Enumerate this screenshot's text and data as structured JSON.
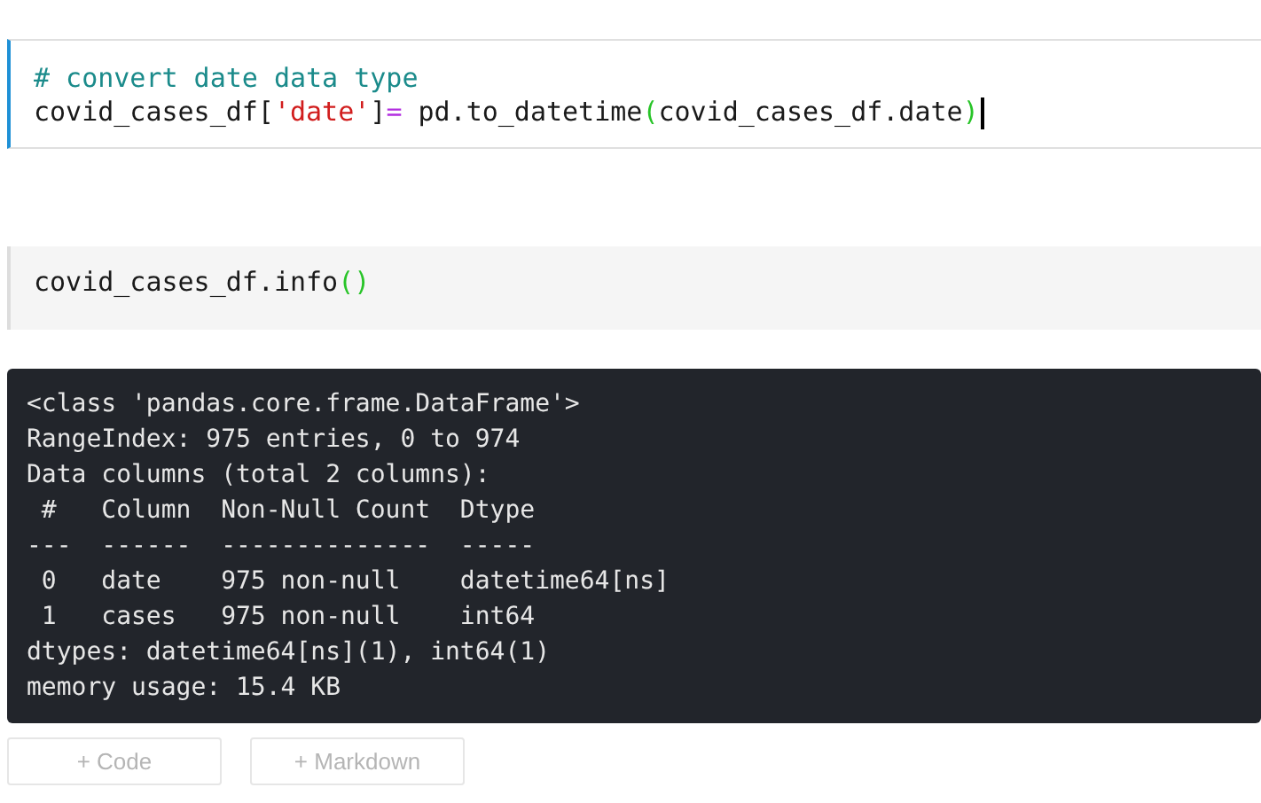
{
  "cells": [
    {
      "kind": "code",
      "active": true,
      "lines": [
        [
          {
            "kind": "comment",
            "text": "# convert date data type"
          }
        ],
        [
          {
            "kind": "plain",
            "text": "covid_cases_df["
          },
          {
            "kind": "string",
            "text": "'date'"
          },
          {
            "kind": "plain",
            "text": "]"
          },
          {
            "kind": "operator",
            "text": "="
          },
          {
            "kind": "plain",
            "text": " pd.to_datetime"
          },
          {
            "kind": "paren",
            "text": "("
          },
          {
            "kind": "plain",
            "text": "covid_cases_df.date"
          },
          {
            "kind": "paren",
            "text": ")"
          }
        ]
      ]
    },
    {
      "kind": "code",
      "active": false,
      "lines": [
        [
          {
            "kind": "plain",
            "text": "covid_cases_df.info"
          },
          {
            "kind": "paren",
            "text": "()"
          }
        ]
      ],
      "output": [
        "<class 'pandas.core.frame.DataFrame'>",
        "RangeIndex: 975 entries, 0 to 974",
        "Data columns (total 2 columns):",
        " #   Column  Non-Null Count  Dtype         ",
        "---  ------  --------------  -----         ",
        " 0   date    975 non-null    datetime64[ns]",
        " 1   cases   975 non-null    int64         ",
        "dtypes: datetime64[ns](1), int64(1)",
        "memory usage: 15.4 KB"
      ]
    }
  ],
  "add_buttons": [
    "+ Code",
    "+ Markdown"
  ]
}
